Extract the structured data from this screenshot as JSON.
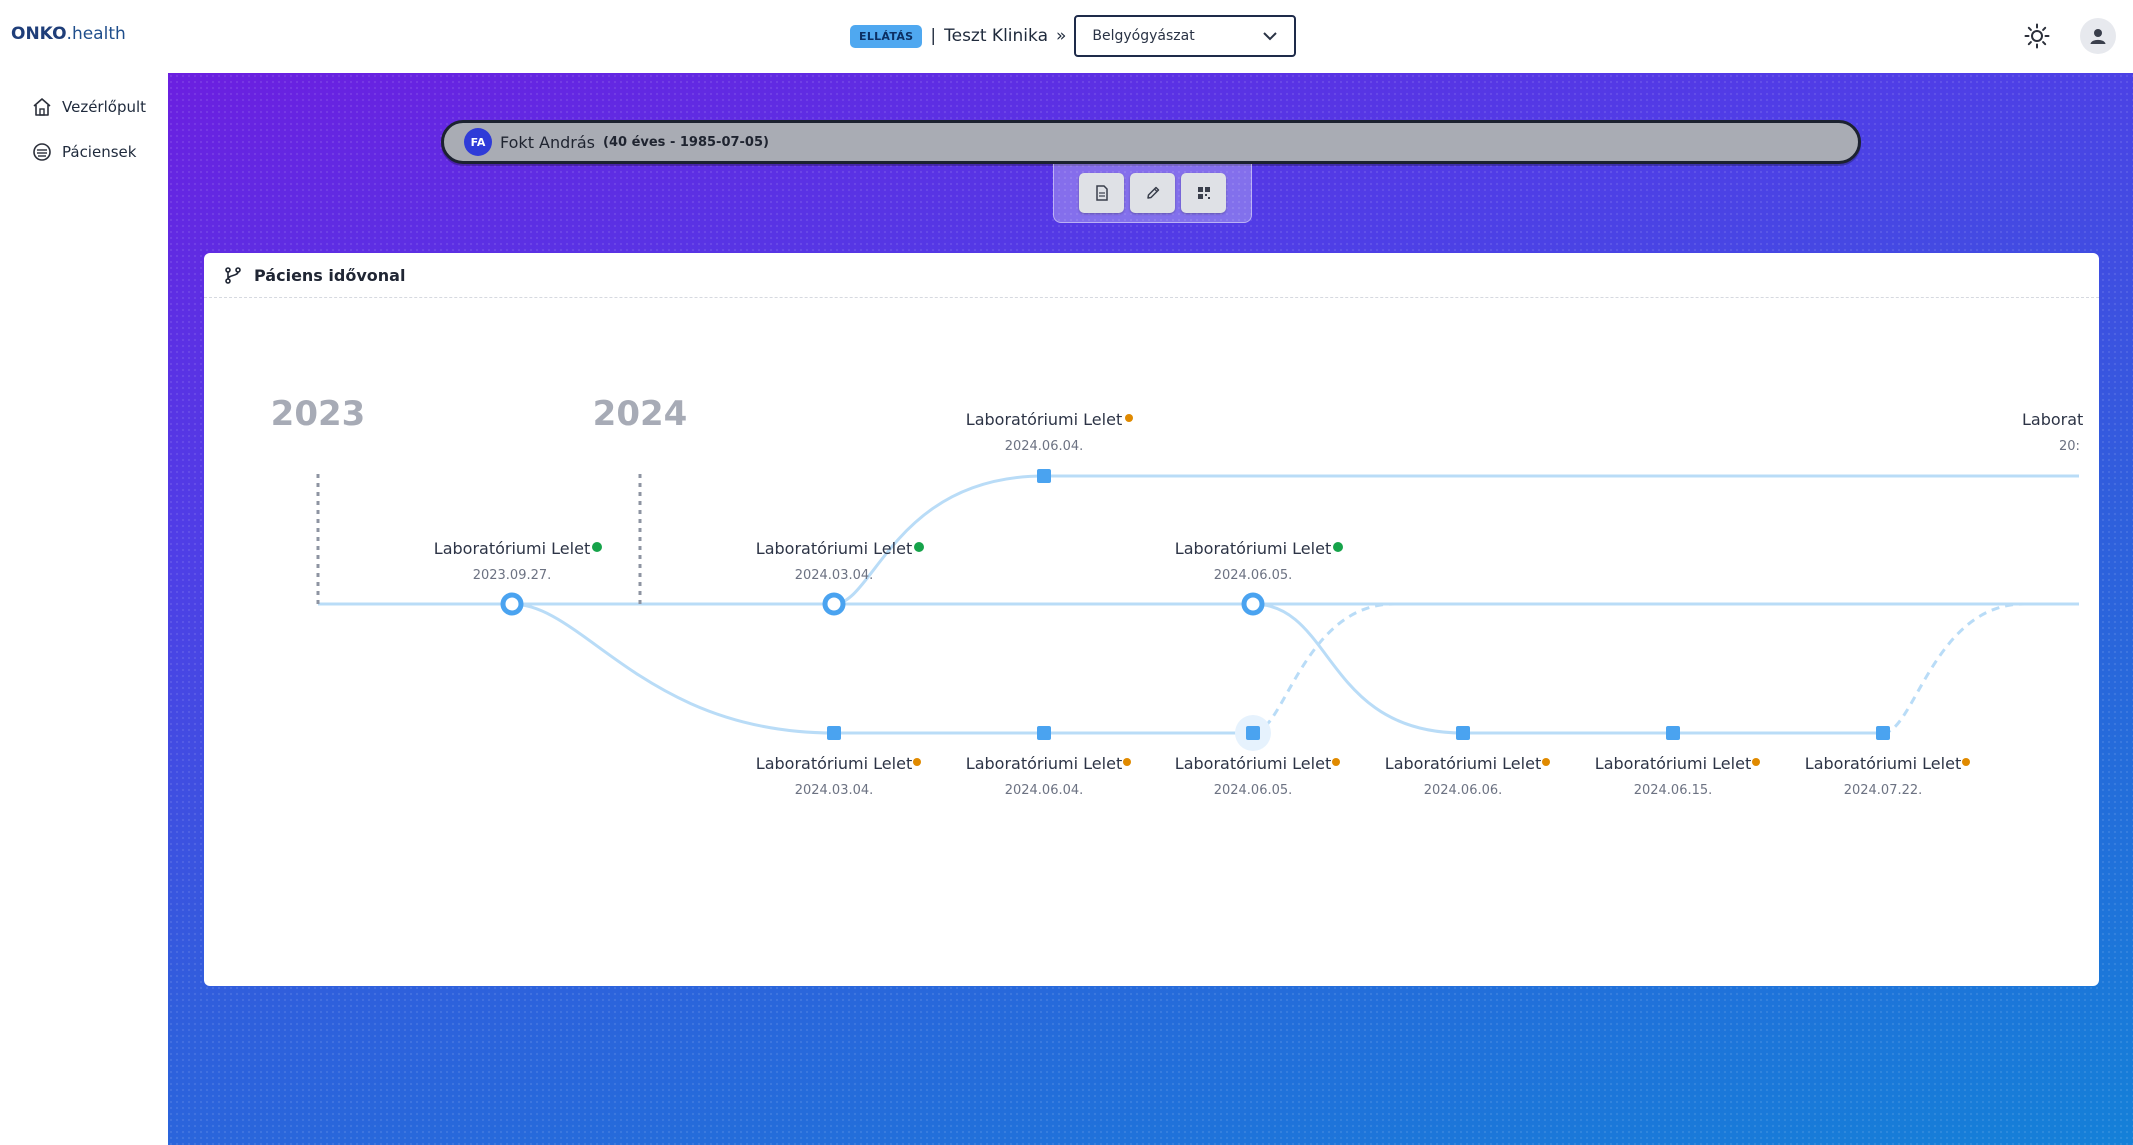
{
  "app": {
    "brand_bold": "ONKO",
    "brand_rest": ".health"
  },
  "context": {
    "badge": "ELLÁTÁS",
    "separator": "|",
    "clinic": "Teszt Klinika",
    "arrow": "»",
    "department": "Belgyógyászat"
  },
  "sidebar": {
    "items": [
      {
        "label": "Vezérlőpult",
        "icon": "home-icon"
      },
      {
        "label": "Páciensek",
        "icon": "patients-icon"
      }
    ]
  },
  "patient": {
    "initials": "FA",
    "name": "Fokt András",
    "meta": "(40 éves - 1985-07-05)"
  },
  "toolbox": {
    "buttons": [
      {
        "icon": "document-icon"
      },
      {
        "icon": "pencil-icon"
      },
      {
        "icon": "qr-icon"
      }
    ]
  },
  "timeline": {
    "title": "Páciens idővonal",
    "colors": {
      "line": "#b9dcf7",
      "node": "#4aa3f0",
      "green": "#16a34a",
      "orange": "#e08a00"
    },
    "years": [
      "2023",
      "2024"
    ],
    "events": [
      {
        "title": "Laboratóriumi Lelet",
        "date": "2023.09.27.",
        "status": "green"
      },
      {
        "title": "Laboratóriumi Lelet",
        "date": "2024.03.04.",
        "status": "green"
      },
      {
        "title": "Laboratóriumi Lelet",
        "date": "2024.06.04.",
        "status": "orange"
      },
      {
        "title": "Laboratóriumi Lelet",
        "date": "2024.06.05.",
        "status": "green"
      },
      {
        "title": "Laboratóriumi Lelet",
        "date": "2024.03.04.",
        "status": "orange"
      },
      {
        "title": "Laboratóriumi Lelet",
        "date": "2024.06.04.",
        "status": "orange"
      },
      {
        "title": "Laboratóriumi Lelet",
        "date": "2024.06.05.",
        "status": "orange"
      },
      {
        "title": "Laboratóriumi Lelet",
        "date": "2024.06.06.",
        "status": "orange"
      },
      {
        "title": "Laboratóriumi Lelet",
        "date": "2024.06.15.",
        "status": "orange"
      },
      {
        "title": "Laboratóriumi Lelet",
        "date": "2024.07.22.",
        "status": "orange"
      },
      {
        "title": "Laborat",
        "date": "20:",
        "status": "none"
      }
    ]
  }
}
